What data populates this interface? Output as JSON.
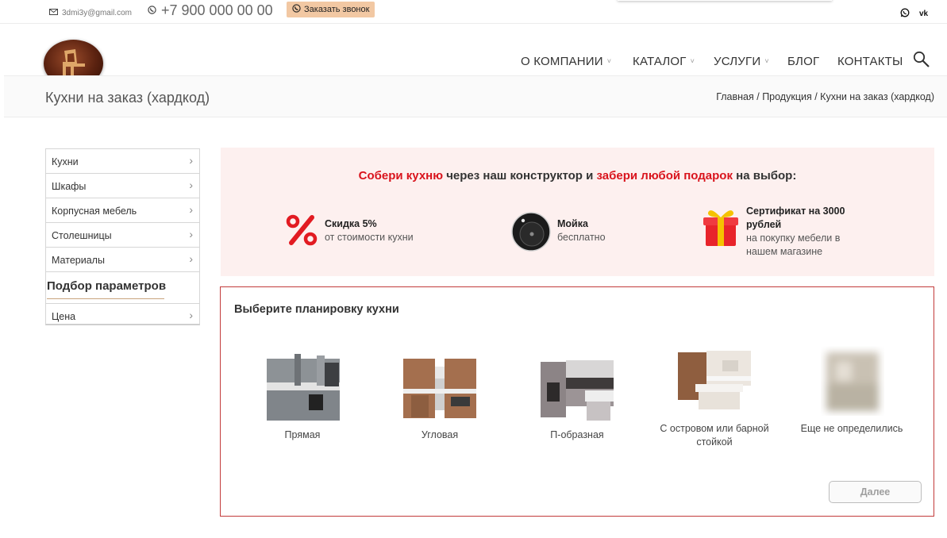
{
  "topbar": {
    "email": "3dmi3y@gmail.com",
    "phone": "+7 900 000 00 00",
    "callback_label": "Заказать звонок"
  },
  "nav": {
    "items": [
      {
        "label": "О КОМПАНИИ",
        "has_dropdown": true
      },
      {
        "label": "КАТАЛОГ",
        "has_dropdown": true
      },
      {
        "label": "УСЛУГИ",
        "has_dropdown": true
      },
      {
        "label": "БЛОГ",
        "has_dropdown": false
      },
      {
        "label": "КОНТАКТЫ",
        "has_dropdown": false
      }
    ],
    "dropdown_glyph": "˅"
  },
  "page": {
    "title": "Кухни на заказ (хардкод)"
  },
  "breadcrumb": {
    "items": [
      "Главная",
      "Продукция",
      "Кухни на заказ (хардкод)"
    ],
    "separator": " / "
  },
  "sidebar": {
    "items": [
      "Кухни",
      "Шкафы",
      "Корпусная мебель",
      "Столешницы",
      "Материалы"
    ],
    "filter_title": "Подбор параметров",
    "filter_items": [
      "Цена"
    ]
  },
  "promo": {
    "headline_red1": "Собери кухню",
    "headline_mid": " через наш конструктор и ",
    "headline_red2": "забери любой подарок",
    "headline_end": " на выбор:",
    "perks": [
      {
        "title": "Скидка 5%",
        "text": "от стоимости кухни",
        "icon": "percent-icon"
      },
      {
        "title": "Мойка",
        "text": "бесплатно",
        "icon": "sink-icon"
      },
      {
        "title": "Сертификат на 3000 рублей",
        "text": "на покупку мебели в нашем магазине",
        "icon": "gift-icon"
      }
    ]
  },
  "layout_picker": {
    "title": "Выберите планировку кухни",
    "options": [
      "Прямая",
      "Угловая",
      "П-образная",
      "С островом или барной стойкой",
      "Еще не определились"
    ],
    "next_label": "Далее"
  },
  "colors": {
    "accent_red": "#d9141d",
    "promo_bg": "#fdf0ef",
    "callback_bg": "#f2c8a3",
    "frame_red": "#c23b3b"
  }
}
